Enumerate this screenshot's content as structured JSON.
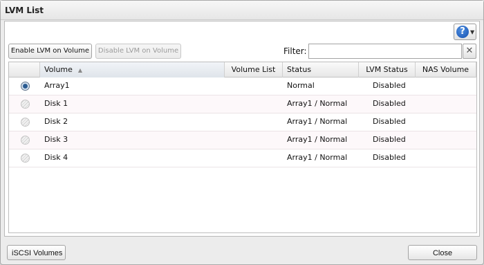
{
  "window": {
    "title": "LVM List"
  },
  "toolbar": {
    "enable_label": "Enable LVM on Volume",
    "disable_label": "Disable LVM on Volume",
    "filter_label": "Filter:",
    "filter_value": "",
    "clear_icon": "close-icon",
    "help_icon": "help-icon"
  },
  "table": {
    "columns": [
      "Volume",
      "Volume List",
      "Status",
      "LVM Status",
      "NAS Volume"
    ],
    "sorted_column": "Volume",
    "sort_direction": "ascending",
    "rows": [
      {
        "selected": true,
        "volume": "Array1",
        "volume_list": "",
        "status": "Normal",
        "lvm_status": "Disabled",
        "nas_volume": ""
      },
      {
        "selected": false,
        "volume": "Disk 1",
        "volume_list": "",
        "status": "Array1 / Normal",
        "lvm_status": "Disabled",
        "nas_volume": ""
      },
      {
        "selected": false,
        "volume": "Disk 2",
        "volume_list": "",
        "status": "Array1 / Normal",
        "lvm_status": "Disabled",
        "nas_volume": ""
      },
      {
        "selected": false,
        "volume": "Disk 3",
        "volume_list": "",
        "status": "Array1 / Normal",
        "lvm_status": "Disabled",
        "nas_volume": ""
      },
      {
        "selected": false,
        "volume": "Disk 4",
        "volume_list": "",
        "status": "Array1 / Normal",
        "lvm_status": "Disabled",
        "nas_volume": ""
      }
    ]
  },
  "footer": {
    "iscsi_label": "iSCSI Volumes",
    "close_label": "Close"
  },
  "colors": {
    "selected_radio": "#2a5b91",
    "help_button": "#1550b0",
    "alt_row": "#fdf8fa"
  }
}
